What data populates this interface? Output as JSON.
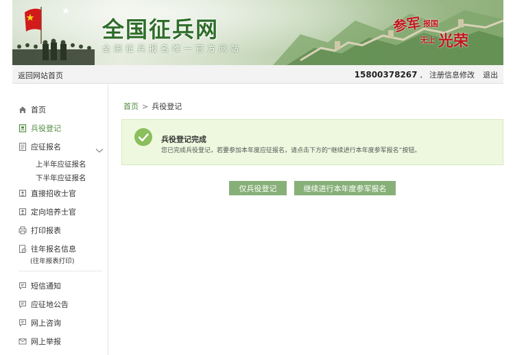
{
  "banner": {
    "site_title": "全国征兵网",
    "site_subtitle": "全国征兵报名唯一官方网站",
    "slogan": {
      "line1": "参军",
      "line2": "报国",
      "line3": "无上",
      "line4": "光荣"
    }
  },
  "topbar": {
    "back_home": "返回网站首页",
    "phone": "15800378267",
    "comma": ",",
    "modify_label": "注册信息修改",
    "logout_label": "退出"
  },
  "sidebar": {
    "items": [
      {
        "label": "首页",
        "icon": "home-icon"
      },
      {
        "label": "兵役登记",
        "icon": "register-icon"
      },
      {
        "label": "应征报名",
        "icon": "form-icon"
      },
      {
        "label": "直接招收士官",
        "icon": "badge-icon"
      },
      {
        "label": "定向培养士官",
        "icon": "badge-icon"
      },
      {
        "label": "打印报表",
        "icon": "printer-icon"
      },
      {
        "label": "往年报名信息",
        "icon": "history-icon"
      },
      {
        "label": "短信通知",
        "icon": "message-icon"
      },
      {
        "label": "应征地公告",
        "icon": "message-icon"
      },
      {
        "label": "网上咨询",
        "icon": "message-icon"
      },
      {
        "label": "网上举报",
        "icon": "mail-icon"
      }
    ],
    "sub_items": [
      "上半年应征报名",
      "下半年应征报名"
    ],
    "history_note": "(往年报表打印)"
  },
  "main": {
    "breadcrumb": {
      "home": "首页",
      "separator": ">",
      "current": "兵役登记"
    },
    "notice": {
      "title": "兵役登记完成",
      "description": "您已完成兵役登记，若要参加本年度应征报名，请点击下方的“继续进行本年度参军报名”按钮。"
    },
    "buttons": {
      "only_register": "仅兵役登记",
      "continue_apply": "继续进行本年度参军报名"
    }
  },
  "colors": {
    "accent_green": "#4e8a3e",
    "button_green": "#87b078",
    "notice_bg": "#eef8df",
    "check_green": "#8abf5c"
  }
}
